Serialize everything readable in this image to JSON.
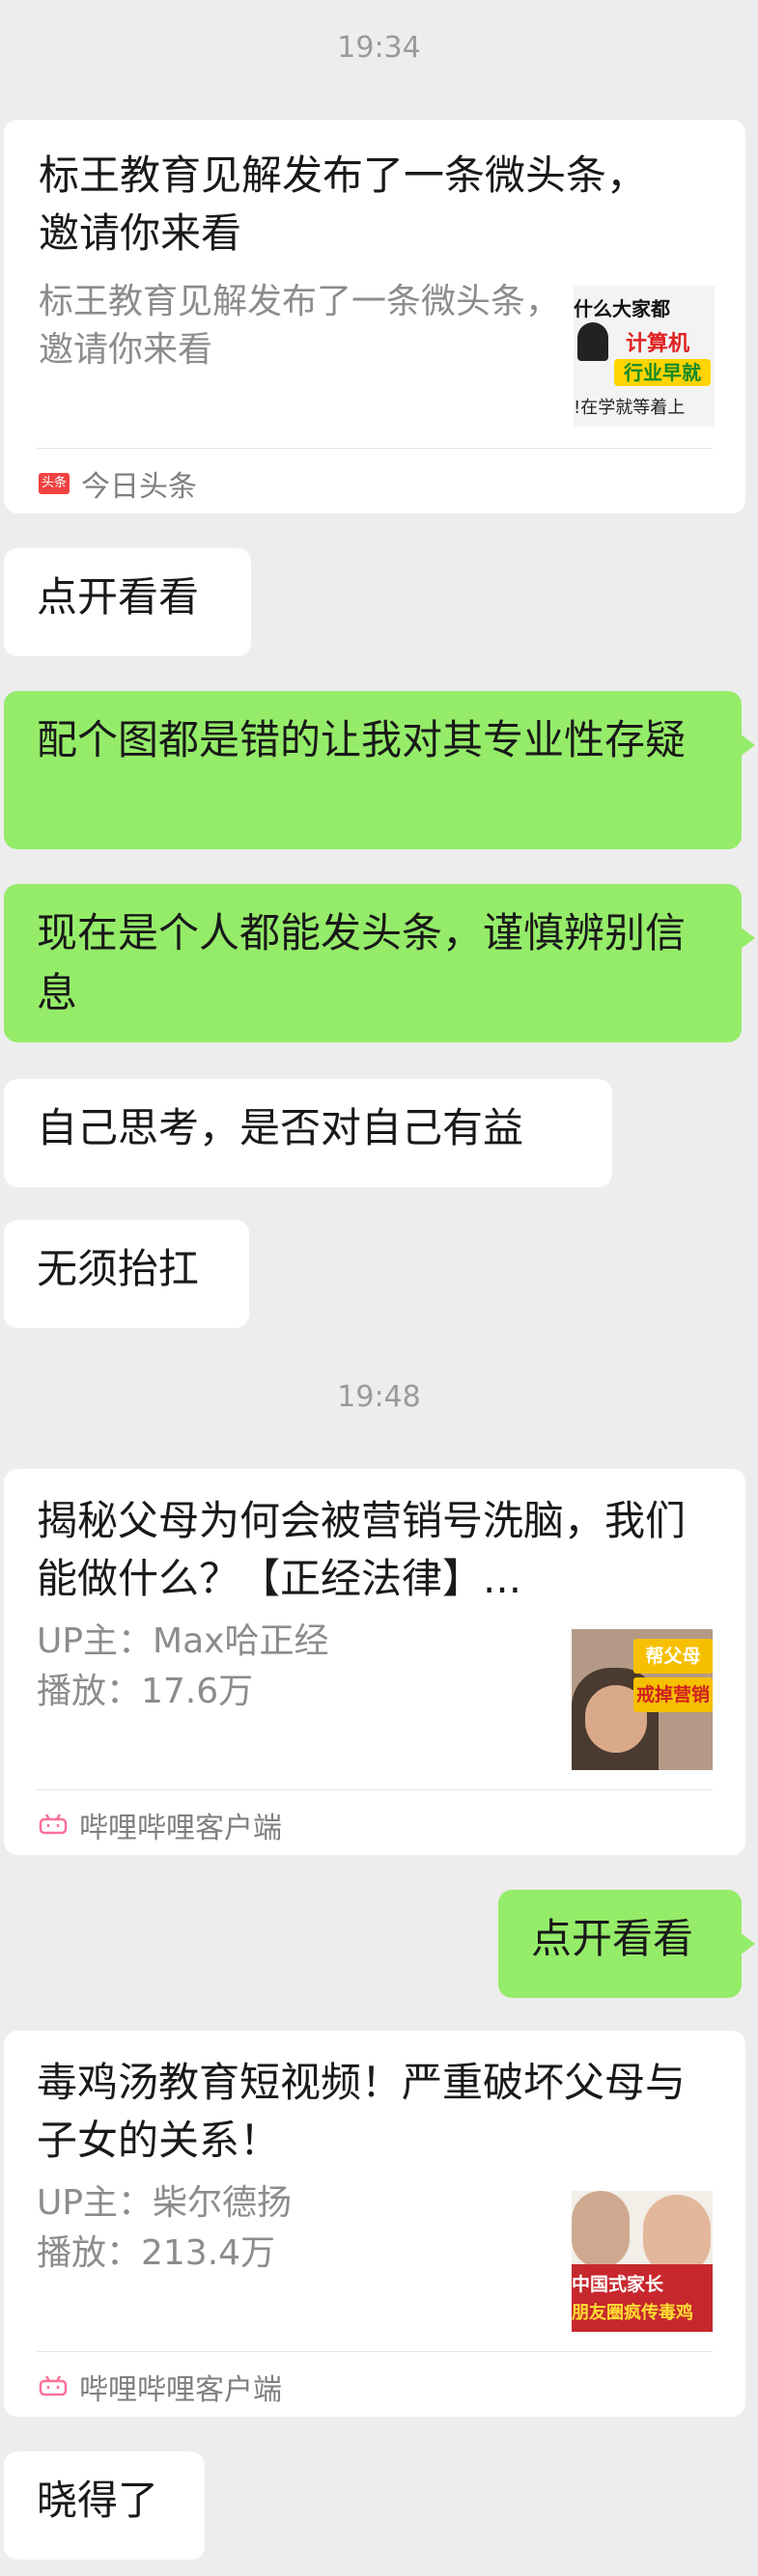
{
  "timestamps": [
    "19:34",
    "19:48"
  ],
  "messages": {
    "m1": {
      "title": "标王教育见解发布了一条微头条，邀请你来看",
      "desc": "标王教育见解发布了一条微头条，邀请你来看",
      "thumb_text": [
        "什么大家都",
        "计算机",
        "行业早就",
        "!在学就等着上"
      ],
      "source": "今日头条",
      "source_icon": "toutiao-icon"
    },
    "m2": "点开看看",
    "m3": "配个图都是错的让我对其专业性存疑",
    "m4": "现在是个人都能发头条，谨慎辨别信息",
    "m5": "自己思考，是否对自己有益",
    "m6": "无须抬扛",
    "m7": {
      "title": "揭秘父母为何会被营销号洗脑，我们能做什么？【正经法律】...",
      "uploader": "UP主：Max哈正经",
      "plays": "播放：17.6万",
      "thumb_text": [
        "帮父母",
        "戒掉营销"
      ],
      "source": "哔哩哔哩客户端",
      "source_icon": "bilibili-icon"
    },
    "m8": "点开看看",
    "m9": {
      "title": "毒鸡汤教育短视频！严重破坏父母与子女的关系！",
      "uploader": "UP主：柴尔德扬",
      "plays": "播放：213.4万",
      "thumb_text": [
        "中国式家长",
        "朋友圈疯传毒鸡"
      ],
      "source": "哔哩哔哩客户端",
      "source_icon": "bilibili-icon"
    },
    "m10": "晓得了"
  },
  "colors": {
    "background": "#ededed",
    "incoming_bubble": "#ffffff",
    "outgoing_bubble": "#95ec69",
    "toutiao_red": "#f04142",
    "bilibili_pink": "#fb7299"
  }
}
